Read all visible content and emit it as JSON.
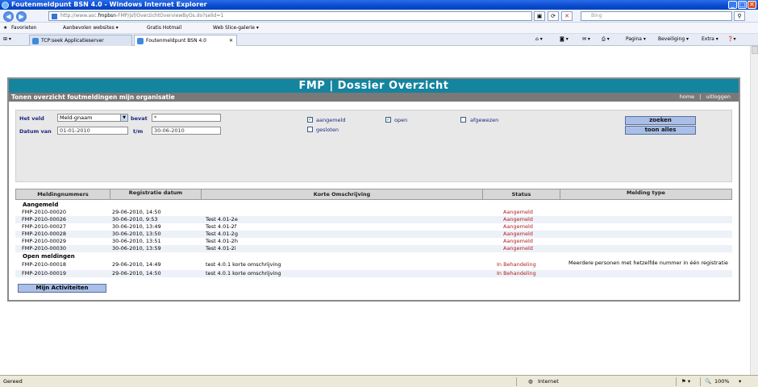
{
  "window": {
    "title": "Foutenmeldpunt BSN 4.0 - Windows Internet Explorer",
    "minimize": "_",
    "maximize": "□",
    "close": "✕"
  },
  "address": {
    "back": "◀",
    "forward": "▶",
    "url_prefix": "http://www.asc.",
    "url_host": "fmpbsn",
    "url_rest": "-FMP/jsf/OverzichtOverviewByOs.do?selid=1",
    "search_placeholder": "Bing"
  },
  "favorites": {
    "label": "Favorieten",
    "items": [
      "Aanbevolen websites ▾",
      "Gratis Hotmail",
      "Web Slice-galerie ▾"
    ]
  },
  "tabs": [
    {
      "label": "TCP:seek Applicatieserver"
    },
    {
      "label": "Foutenmeldpunt BSN 4.0"
    }
  ],
  "command_bar": [
    "Pagina ▾",
    "Beveiliging ▾",
    "Extra ▾"
  ],
  "app": {
    "header": "FMP | Dossier Overzicht",
    "subheader": "Tonen overzicht foutmeldingen mijn organisatie",
    "links": [
      "home",
      "uitloggen"
    ],
    "filter": {
      "field_label": "Het veld",
      "field_value": "Meld-gnaam",
      "contains_label": "bevat",
      "contains_value": "*",
      "date_from_label": "Datum van",
      "date_from_value": "01-01-2010",
      "date_to_label": "t/m",
      "date_to_value": "30-06-2010",
      "checkboxes": [
        {
          "label": "aangemeld",
          "checked": true
        },
        {
          "label": "open",
          "checked": true
        },
        {
          "label": "afgewezen",
          "checked": false
        },
        {
          "label": "gesloten",
          "checked": false
        }
      ],
      "search_button": "zoeken",
      "show_all_button": "toon alles"
    },
    "table": {
      "headers": [
        "Meldingnummers",
        "Registratie datum",
        "Korte Omschrijving",
        "Status",
        "Melding type"
      ],
      "groups": [
        {
          "title": "Aangemeld",
          "rows": [
            {
              "id": "FMP-2010-00020",
              "date": "29-06-2010, 14:50",
              "desc": "",
              "status": "Aangemeld",
              "type": ""
            },
            {
              "id": "FMP-2010-00026",
              "date": "30-06-2010, 9:53",
              "desc": "Test 4.01-2e",
              "status": "Aangemeld",
              "type": ""
            },
            {
              "id": "FMP-2010-00027",
              "date": "30-06-2010, 13:49",
              "desc": "Test 4.01-2f",
              "status": "Aangemeld",
              "type": ""
            },
            {
              "id": "FMP-2010-00028",
              "date": "30-06-2010, 13:50",
              "desc": "Test 4.01-2g",
              "status": "Aangemeld",
              "type": ""
            },
            {
              "id": "FMP-2010-00029",
              "date": "30-06-2010, 13:51",
              "desc": "Test 4.01-2h",
              "status": "Aangemeld",
              "type": ""
            },
            {
              "id": "FMP-2010-00030",
              "date": "30-06-2010, 13:59",
              "desc": "Test 4.01-2i",
              "status": "Aangemeld",
              "type": ""
            }
          ]
        },
        {
          "title": "Open meldingen",
          "rows": [
            {
              "id": "FMP-2010-00018",
              "date": "29-06-2010, 14:49",
              "desc": "test 4.0.1 korte omschrijving",
              "status": "In Behandeling",
              "type": "Meerdere personen met hetzelfde nummer in één registratie"
            },
            {
              "id": "FMP-2010-00019",
              "date": "29-06-2010, 14:50",
              "desc": "test 4.0.1 korte omschrijving",
              "status": "In Behandeling",
              "type": ""
            }
          ]
        }
      ]
    },
    "bottom_button": "Mijn Activiteiten"
  },
  "statusbar": {
    "left": "Gereed",
    "zone": "Internet",
    "zoom": "100%"
  }
}
